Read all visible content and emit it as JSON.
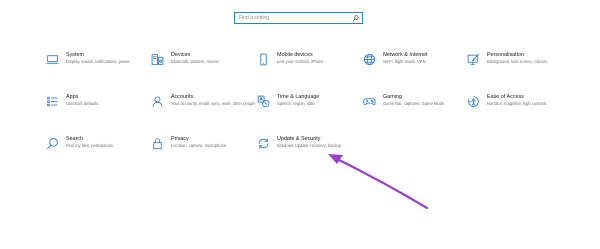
{
  "search": {
    "placeholder": "Find a setting"
  },
  "accent_color": "#2b7dd6",
  "annotation_color": "#9b3ec9",
  "tiles": [
    {
      "title": "System",
      "desc": "Display, sound, notifications, power",
      "icon": "laptop-icon"
    },
    {
      "title": "Devices",
      "desc": "Bluetooth, printers, mouse",
      "icon": "devices-icon"
    },
    {
      "title": "Mobile devices",
      "desc": "Link your Android, iPhone",
      "icon": "phone-icon"
    },
    {
      "title": "Network & Internet",
      "desc": "Wi-Fi, flight mode, VPN",
      "icon": "globe-icon"
    },
    {
      "title": "Personalisation",
      "desc": "Background, lock screen, colours",
      "icon": "pen-monitor-icon"
    },
    {
      "title": "Apps",
      "desc": "Uninstall, defaults",
      "icon": "apps-list-icon"
    },
    {
      "title": "Accounts",
      "desc": "Your accounts, email, sync, work, other people",
      "icon": "person-icon"
    },
    {
      "title": "Time & Language",
      "desc": "Speech, region, date",
      "icon": "time-language-icon"
    },
    {
      "title": "Gaming",
      "desc": "Game Bar, captures, Game Mode",
      "icon": "gamepad-icon"
    },
    {
      "title": "Ease of Access",
      "desc": "Narrator, magnifier, high contrast",
      "icon": "ease-of-access-icon"
    },
    {
      "title": "Search",
      "desc": "Find my files, permissions",
      "icon": "search-icon"
    },
    {
      "title": "Privacy",
      "desc": "Location, camera, microphone",
      "icon": "lock-icon"
    },
    {
      "title": "Update & Security",
      "desc": "Windows Update, recovery, backup",
      "icon": "sync-icon"
    }
  ]
}
